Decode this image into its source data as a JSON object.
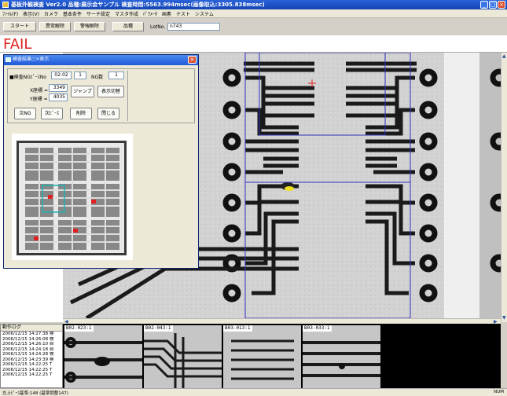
{
  "window": {
    "title": "基板外観検査 Ver2.0 品種:展示会サンプル 検査時間:5563.994msec(画像取込:3305.838msec)",
    "minimize": "_",
    "maximize": "□",
    "close": "×"
  },
  "menu": [
    "ﾌｧｲﾙ(F)",
    "表示(V)",
    "カメラ",
    "基本条件",
    "サーチ設定",
    "マスタ作成",
    "ﾊﾟﾗﾒｰﾀ",
    "画素",
    "テスト",
    "システム"
  ],
  "toolbar": {
    "start": "スタート",
    "abnormal_release": "異常解除",
    "alarm_release": "警報解除",
    "product": "品種",
    "lot_label": "LotNo.",
    "lot_value": "n743"
  },
  "result": "FAIL",
  "dialog": {
    "title": "検査結果○×表示",
    "close": "×",
    "ng_sheet_label": "■検査NGﾋﾟｰｽNo",
    "ng_sheet_value": "02-02",
    "ng_sheet_count": "1",
    "ng_count_label": "NG数",
    "ng_count_value": "1",
    "x_label": "X座標 =",
    "x_value": "3349",
    "y_label": "Y座標 =",
    "y_value": "4035",
    "jump": "ジャンプ",
    "toggle_display": "表示切替",
    "next_ng": "次NG",
    "next_piece": "次ﾋﾟｰｽ",
    "delete": "削除",
    "close_btn": "閉じる"
  },
  "log": {
    "header": "動作ログ",
    "lines": [
      "2006/12/15 14:27:38 検",
      "2006/12/15 14:26:08 検",
      "2006/12/15 14:26:10 自",
      "2006/12/15 14:24:18 自",
      "2006/12/15 14:24:28 検",
      "2006/12/15 14:23:39 検",
      "2006/12/15 14:22:25 T",
      "2006/12/15 14:22:25 T",
      "2006/12/15 14:22:25 T"
    ]
  },
  "thumbnails": [
    {
      "label": "B02-023:1"
    },
    {
      "label": "B02-043:1"
    },
    {
      "label": "B03-013:1"
    },
    {
      "label": "B03-033:1"
    }
  ],
  "status": {
    "text": "左上ﾋﾟｰｽ基準:148 (基準調整147)",
    "num": "NUM"
  },
  "colors": {
    "fail": "#e02020",
    "titlebar": "#2a62d8",
    "defect": "#f0e020"
  }
}
